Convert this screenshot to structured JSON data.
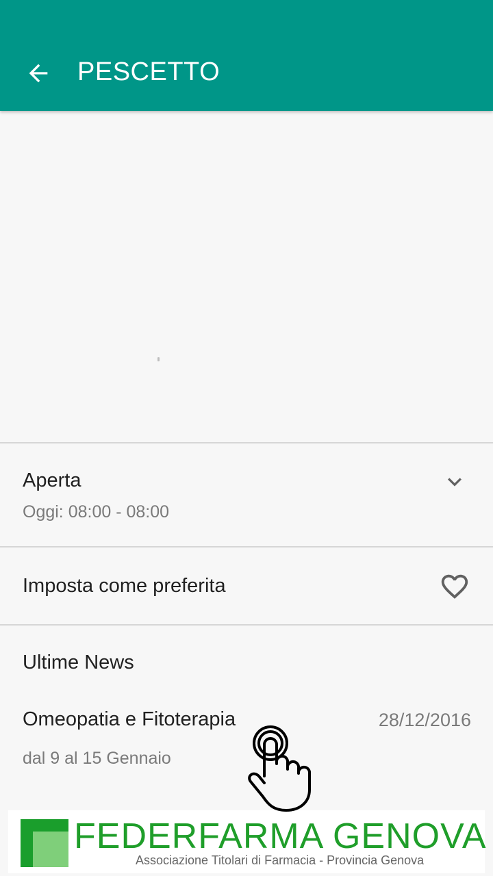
{
  "app_bar": {
    "title": "PESCETTO",
    "color": "#009688",
    "back_icon": "arrow-left-icon"
  },
  "hours": {
    "status": "Aperta",
    "today": "Oggi: 08:00 - 08:00",
    "expand_icon": "chevron-down-icon"
  },
  "favorite": {
    "label": "Imposta come preferita",
    "icon": "heart-outline-icon"
  },
  "news": {
    "heading": "Ultime News",
    "items": [
      {
        "title": "Omeopatia e Fitoterapia",
        "date": "28/12/2016",
        "subtitle": "dal 9 al 15 Gennaio"
      }
    ]
  },
  "banner": {
    "title": "FEDERFARMA GENOVA",
    "subtitle": "Associazione Titolari di Farmacia - Provincia Genova",
    "brand_color": "#1f9e2a"
  }
}
